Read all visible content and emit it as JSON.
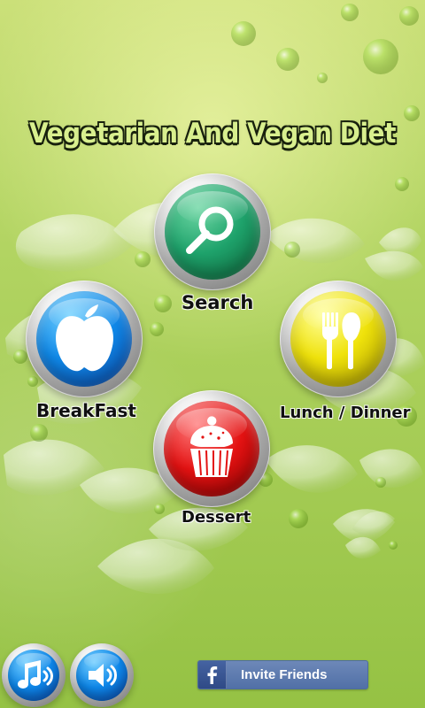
{
  "app": {
    "title": "Vegetarian And Vegan Diet"
  },
  "menu": {
    "search": {
      "label": "Search",
      "icon": "search-icon",
      "color": "#1ea26b"
    },
    "breakfast": {
      "label": "BreakFast",
      "icon": "apple-icon",
      "color": "#0f88e8"
    },
    "lunch_dinner": {
      "label": "Lunch / Dinner",
      "icon": "fork-knife-icon",
      "color": "#efe20b"
    },
    "dessert": {
      "label": "Dessert",
      "icon": "cupcake-icon",
      "color": "#e31212"
    }
  },
  "footer": {
    "music_button": {
      "icon": "music-note-icon"
    },
    "sound_button": {
      "icon": "speaker-icon"
    },
    "invite_friends": {
      "label": "Invite Friends",
      "icon": "facebook-icon",
      "color": "#5170a7"
    }
  }
}
